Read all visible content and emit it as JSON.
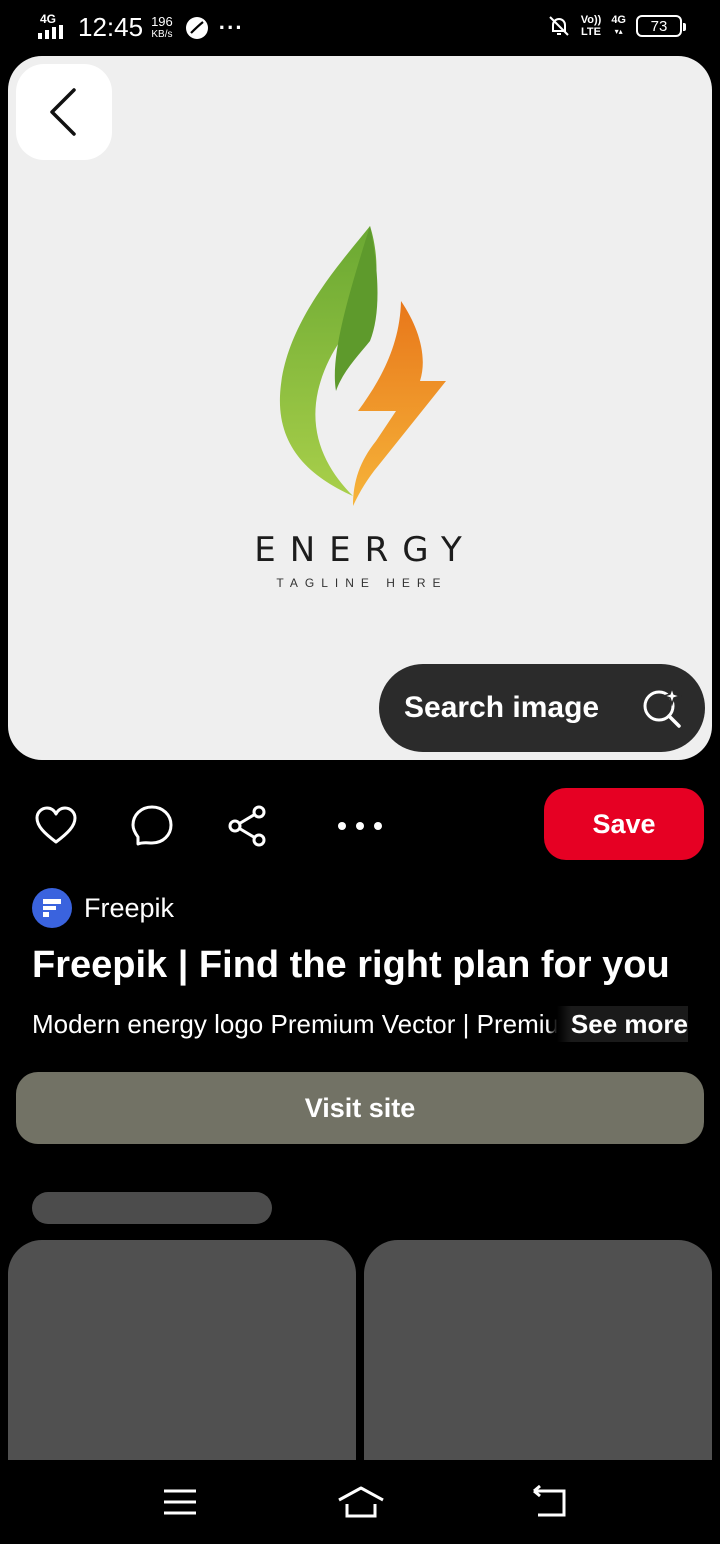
{
  "status_bar": {
    "network_label": "4G",
    "time": "12:45",
    "speed_value": "196",
    "speed_unit": "KB/s",
    "volte_top": "Vo))",
    "volte_bottom": "LTE",
    "net_type": "4G",
    "battery": "73"
  },
  "image": {
    "logo_word": "ENERGY",
    "tagline": "TAGLINE HERE",
    "colors": {
      "leaf": "#7fb83c",
      "bolt": "#f08a1e",
      "background": "#efefef"
    }
  },
  "search_image": {
    "label": "Search image"
  },
  "actions": {
    "save_label": "Save"
  },
  "source": {
    "name": "Freepik",
    "avatar_letter": "F"
  },
  "pin": {
    "title": "Freepik | Find the right plan for you",
    "description": "Modern energy logo Premium Vector | Premium Vector",
    "see_more": "See more"
  },
  "visit_site": {
    "label": "Visit site"
  },
  "theme": {
    "save_color": "#e60023",
    "visit_color": "#727265"
  }
}
